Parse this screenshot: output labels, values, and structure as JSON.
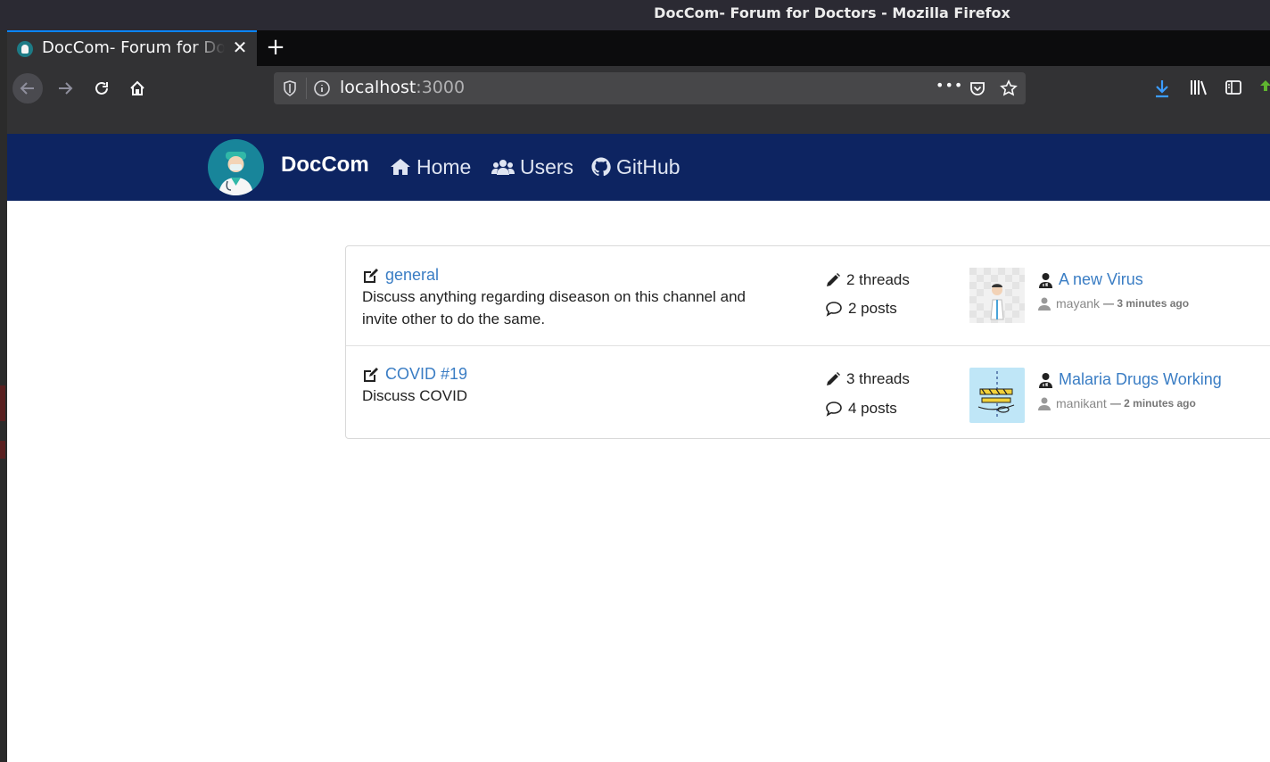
{
  "window": {
    "title": "DocCom- Forum for Doctors - Mozilla Firefox"
  },
  "tab": {
    "title": "DocCom- Forum for Doctors",
    "close_glyph": "✕",
    "new_tab_glyph": "+"
  },
  "urlbar": {
    "host": "localhost",
    "port": ":3000",
    "more_glyph": "•••"
  },
  "site": {
    "brand": "DocCom",
    "nav": [
      {
        "label": "Home",
        "icon": "home-icon"
      },
      {
        "label": "Users",
        "icon": "users-icon"
      },
      {
        "label": "GitHub",
        "icon": "github-icon"
      }
    ]
  },
  "channels": [
    {
      "name": "general",
      "description": "Discuss anything regarding diseason on this channel and invite other to do the same.",
      "threads": "2 threads",
      "posts": "2 posts",
      "last_post": {
        "title": "A new Virus",
        "author": "mayank",
        "time": "— 3 minutes ago"
      }
    },
    {
      "name": "COVID #19",
      "description": "Discuss COVID",
      "threads": "3 threads",
      "posts": "4 posts",
      "last_post": {
        "title": "Malaria Drugs Working",
        "author": "manikant",
        "time": "— 2 minutes ago"
      }
    }
  ],
  "colors": {
    "site_nav": "#0d2461",
    "link": "#3a7dc4",
    "tab_accent": "#0a84ff",
    "download_icon": "#3b9cff"
  }
}
